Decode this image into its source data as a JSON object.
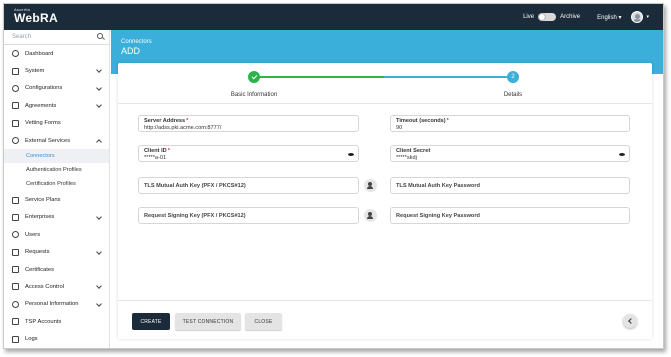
{
  "brand": {
    "tagline": "Ascertia",
    "name": "WebRA"
  },
  "topbar": {
    "live_label": "Live",
    "archive_label": "Archive",
    "language": "English ▾",
    "avatar_caret": "▾"
  },
  "sidebar": {
    "search_placeholder": "Search",
    "items": [
      {
        "label": "Dashboard",
        "icon": "dashboard-icon"
      },
      {
        "label": "System",
        "icon": "monitor-icon"
      },
      {
        "label": "Configurations",
        "icon": "gear-icon"
      },
      {
        "label": "Agreements",
        "icon": "handshake-icon"
      },
      {
        "label": "Vetting Forms",
        "icon": "form-icon"
      },
      {
        "label": "External Services",
        "icon": "link-icon"
      },
      {
        "label": "Service Plans",
        "icon": "plan-icon"
      },
      {
        "label": "Enterprises",
        "icon": "building-icon"
      },
      {
        "label": "Users",
        "icon": "user-icon"
      },
      {
        "label": "Requests",
        "icon": "request-icon"
      },
      {
        "label": "Certificates",
        "icon": "certificate-icon"
      },
      {
        "label": "Access Control",
        "icon": "lock-icon"
      },
      {
        "label": "Personal Information",
        "icon": "person-icon"
      },
      {
        "label": "TSP Accounts",
        "icon": "account-icon"
      },
      {
        "label": "Logs",
        "icon": "logs-icon"
      }
    ],
    "sub_items": [
      "Connectors",
      "Authentication Profiles",
      "Certification Profiles"
    ]
  },
  "header": {
    "breadcrumb": "Connectors",
    "title": "ADD"
  },
  "stepper": {
    "step1_label": "Basic Information",
    "step2_label": "Details",
    "step2_number": "2",
    "completed_color": "#2db34a",
    "active_color": "#3aafd9"
  },
  "form": {
    "server_address_label": "Server Address",
    "server_address_value": "http://adss.pki.acme.com:8777/",
    "timeout_label": "Timeout (seconds)",
    "timeout_value": "90",
    "client_id_label": "Client ID",
    "client_id_value": "*****a-01",
    "client_secret_label": "Client Secret",
    "client_secret_value": "*****skdj",
    "tls_key_label": "TLS Mutual Auth Key (PFX / PKCS#12)",
    "tls_password_label": "TLS Mutual Auth Key Password",
    "signing_key_label": "Request Signing Key (PFX / PKCS#12)",
    "signing_password_label": "Request Signing Key Password",
    "required_mark": "*"
  },
  "buttons": {
    "create": "CREATE",
    "test": "TEST CONNECTION",
    "close": "CLOSE"
  }
}
